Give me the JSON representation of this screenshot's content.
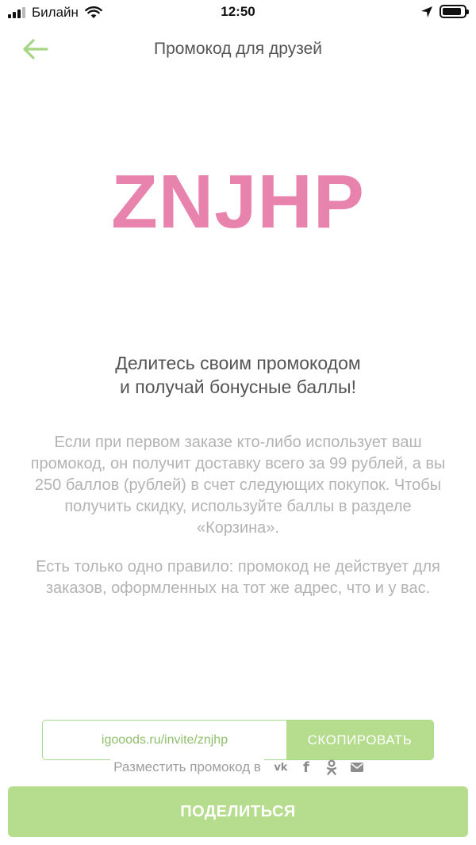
{
  "status_bar": {
    "carrier": "Билайн",
    "time": "12:50",
    "battery_level": 0.9
  },
  "nav": {
    "back_icon": "arrow-left-icon",
    "title": "Промокод для друзей"
  },
  "promo": {
    "code": "ZNJHP"
  },
  "headline": {
    "line1": "Делитесь своим промокодом",
    "line2": "и получай бонусные баллы!"
  },
  "description": {
    "paragraph1": "Если при первом заказе кто-либо использует ваш промокод, он получит доставку всего за 99 рублей, а вы 250 баллов (рублей) в счет следующих покупок. Чтобы получить скидку, используйте баллы в разделе «Корзина».",
    "paragraph2": "Есть только одно правило: промокод не действует для заказов, оформленных на тот же адрес, что и у вас."
  },
  "invite": {
    "link": "igooods.ru/invite/znjhp",
    "copy_label": "СКОПИРОВАТЬ"
  },
  "share": {
    "label": "Разместить промокод в",
    "vk_text": "vk",
    "fb_text": "f",
    "networks": [
      "vk-icon",
      "facebook-icon",
      "odnoklassniki-icon",
      "mail-icon"
    ],
    "button_label": "ПОДЕЛИТЬСЯ"
  },
  "colors": {
    "accent_green": "#b6dc8e",
    "promo_pink": "#e883ad",
    "muted_text": "#b3b3b3"
  }
}
